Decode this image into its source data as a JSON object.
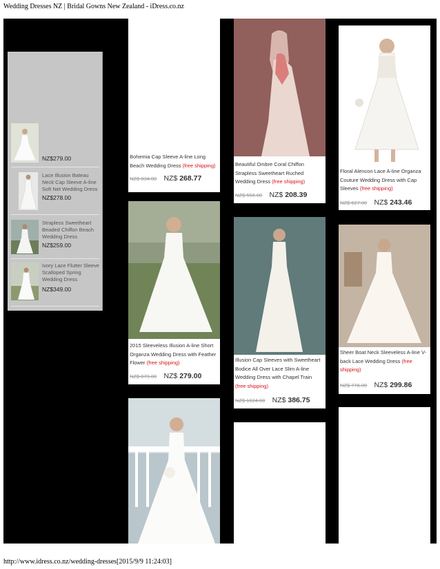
{
  "page": {
    "header": "Wedding Dresses NZ | Bridal Gowns New Zealand - iDress.co.nz",
    "footer": "http://www.idress.co.nz/wedding-dresses[2015/9/9 11:24:03]"
  },
  "sidebar": {
    "items": [
      {
        "title": "",
        "price": "NZ$279.00"
      },
      {
        "title": "Lace Illusion Bateau Neck Cap Sleeve A-line Soft Net Wedding Dress",
        "price": "NZ$278.00"
      },
      {
        "title": "Strapless Sweetheart Beaded Chiffon Beach Wedding Dress",
        "price": "NZ$259.00"
      },
      {
        "title": "Ivory Lace Flutter Sleeve Scalloped Spring Wedding Dress",
        "price": "NZ$349.00"
      }
    ]
  },
  "products": [
    {
      "name": "Bohemia Cap Sleeve A-line Long Beach Wedding Dress",
      "ship": "(free shipping)",
      "old_price": "NZ$ 834.00",
      "currency": "NZ$",
      "price": "268.77"
    },
    {
      "name": "Beautiful Ombre Coral Chiffon Strapless Sweetheart Ruched Wedding Dress",
      "ship": "(free shipping)",
      "old_price": "NZ$ 556.00",
      "currency": "NZ$",
      "price": "208.39"
    },
    {
      "name": "Floral Alencon Lace A-line Organza Couture Wedding Dress with Cap Sleeves",
      "ship": "(free shipping)",
      "old_price": "NZ$ 627.00",
      "currency": "NZ$",
      "price": "243.46"
    },
    {
      "name": "2015 Sleeveless Illusion A-line Short Organza Wedding Dress with Feather Flower",
      "ship": "(free shipping)",
      "old_price": "NZ$ 679.00",
      "currency": "NZ$",
      "price": "279.00"
    },
    {
      "name": "Illusion Cap Sleeves with Sweetheart Bodice All Over Lace Slim A-line Wedding Dress with Chapel Train",
      "ship": "(free shipping)",
      "old_price": "NZ$ 1024.00",
      "currency": "NZ$",
      "price": "386.75"
    },
    {
      "name": "Sheer Boat Neck Sleeveless A-line V-back Lace Wedding Dress",
      "ship": "(free shipping)",
      "old_price": "NZ$ 776.00",
      "currency": "NZ$",
      "price": "299.86"
    }
  ]
}
